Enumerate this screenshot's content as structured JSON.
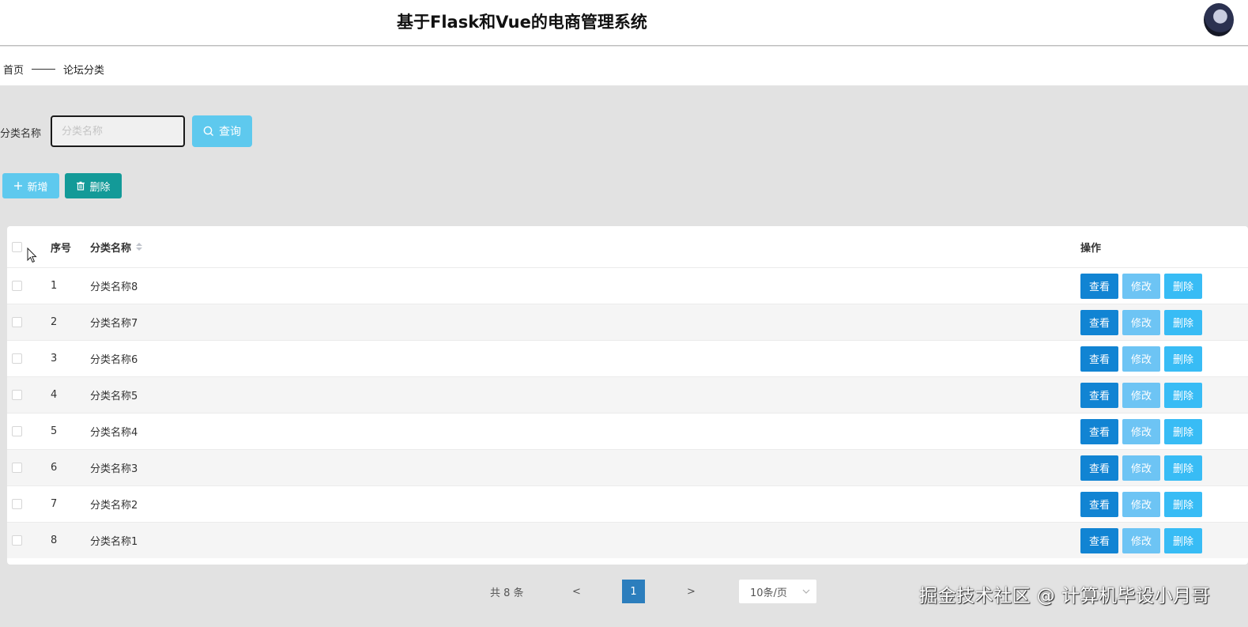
{
  "header": {
    "title": "基于Flask和Vue的电商管理系统"
  },
  "breadcrumb": {
    "home": "首页",
    "current": "论坛分类"
  },
  "search": {
    "label": "分类名称",
    "placeholder": "分类名称",
    "value": "",
    "query_label": "查询"
  },
  "actions": {
    "add_label": "新增",
    "delete_label": "删除"
  },
  "table": {
    "columns": {
      "index": "序号",
      "name": "分类名称",
      "ops": "操作"
    },
    "rows": [
      {
        "index": "1",
        "name": "分类名称8"
      },
      {
        "index": "2",
        "name": "分类名称7"
      },
      {
        "index": "3",
        "name": "分类名称6"
      },
      {
        "index": "4",
        "name": "分类名称5"
      },
      {
        "index": "5",
        "name": "分类名称4"
      },
      {
        "index": "6",
        "name": "分类名称3"
      },
      {
        "index": "7",
        "name": "分类名称2"
      },
      {
        "index": "8",
        "name": "分类名称1"
      }
    ],
    "row_actions": {
      "view": "查看",
      "edit": "修改",
      "delete": "删除"
    }
  },
  "pagination": {
    "total": "共 8 条",
    "prev": "<",
    "current": "1",
    "next": ">",
    "page_size": "10条/页"
  },
  "watermark": "掘金技术社区 @ 计算机毕设小月哥",
  "colors": {
    "primary": "#5ec9ee",
    "teal": "#139a98",
    "view": "#1184d3",
    "edit": "#6dc4f4",
    "delete": "#38bcf5",
    "page_active": "#2c7ebd"
  }
}
